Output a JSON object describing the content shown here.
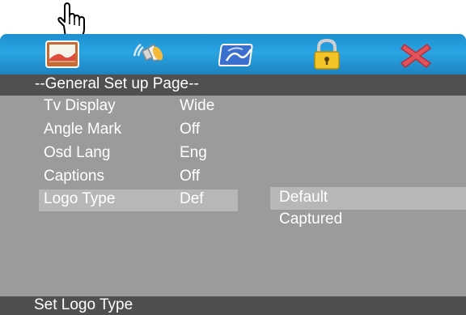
{
  "tabs": [
    {
      "icon": "general-setup-icon"
    },
    {
      "icon": "audio-speaker-icon"
    },
    {
      "icon": "video-picture-icon"
    },
    {
      "icon": "lock-icon"
    },
    {
      "icon": "close-x-icon"
    }
  ],
  "page_title": "--General Set up Page--",
  "settings": [
    {
      "label": "Tv Display",
      "value": "Wide"
    },
    {
      "label": "Angle Mark",
      "value": "Off"
    },
    {
      "label": "Osd Lang",
      "value": "Eng"
    },
    {
      "label": "Captions",
      "value": "Off"
    },
    {
      "label": "Logo Type",
      "value": "Def"
    }
  ],
  "options": [
    "Default",
    "Captured"
  ],
  "status_text": "Set Logo Type",
  "colors": {
    "tab_bar": "#2aa5e3",
    "header_bg": "#505050",
    "menu_bg": "#9b9b9b",
    "highlight": "#b7b7b7",
    "status_bg": "#4f4f4f",
    "text": "#ffffff"
  }
}
